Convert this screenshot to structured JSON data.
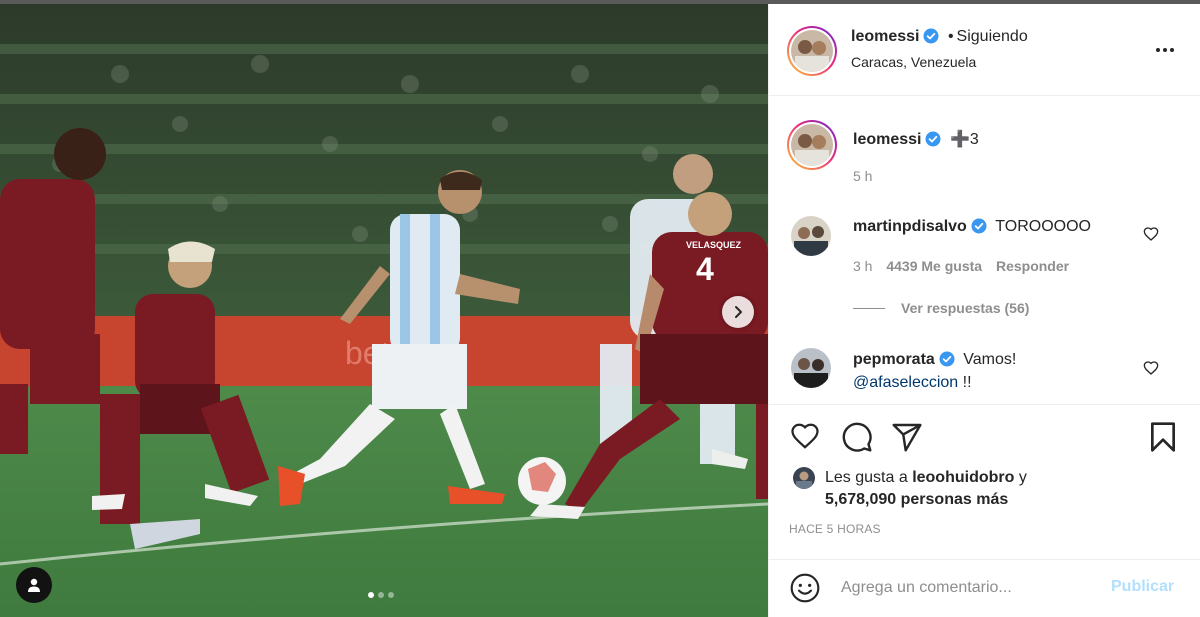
{
  "post": {
    "header": {
      "username": "leomessi",
      "separator": "•",
      "follow_status": "Siguiendo",
      "location": "Caracas, Venezuela",
      "more_icon": "more-options-icon"
    },
    "caption": {
      "username": "leomessi",
      "text": "➕3",
      "time": "5 h"
    },
    "comments": [
      {
        "username": "martinpdisalvo",
        "text": "TOROOOOO",
        "time": "3 h",
        "likes": "4439 Me gusta",
        "reply_label": "Responder",
        "replies_label": "Ver respuestas (56)"
      },
      {
        "username": "pepmorata",
        "text": "Vamos!",
        "mention": "@afaseleccion",
        "text_after": " !!"
      }
    ],
    "likes": {
      "prefix": "Les gusta a",
      "liker": "leoohuidobro",
      "joiner": "y",
      "count": "5,678,090 personas más"
    },
    "timestamp": "HACE 5 HORAS",
    "comment_input": {
      "placeholder": "Agrega un comentario...",
      "publish_label": "Publicar"
    },
    "carousel": {
      "total": 3,
      "current": 1
    },
    "colors": {
      "verified_blue": "#3897f0",
      "link_blue": "#00376b",
      "publish_disabled": "#b2dffc"
    }
  },
  "photo": {
    "jersey_number_home": "4",
    "jersey_name_home": "VELASQUEZ",
    "ad_text": "betsson"
  }
}
